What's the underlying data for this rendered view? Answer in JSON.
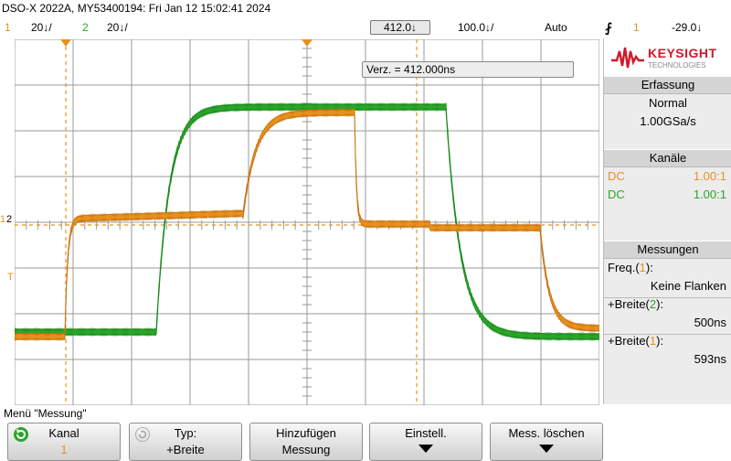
{
  "header": {
    "title": "DSO-X 2022A, MY53400194: Fri Jan 12 15:02:41 2024",
    "ch1_num": "1",
    "ch1_scale": "20↓/",
    "ch2_num": "2",
    "ch2_scale": "20↓/",
    "timebase_delay": "412.0↓",
    "timebase_scale": "100.0↓/",
    "trigger_mode": "Auto",
    "trigger_icon": "rising-edge-icon",
    "trigger_channel": "1",
    "trigger_level": "-29.0↓"
  },
  "screen": {
    "delay_readout": "Verz. = 412.000ns",
    "ch1_marker": "1",
    "ch2_marker": "2",
    "trigger_marker": "T",
    "grid": "on",
    "colors": {
      "ch1": "#e8901c",
      "ch2": "#2aa52a"
    }
  },
  "panel": {
    "brand": "KEYSIGHT",
    "brand_sub": "TECHNOLOGIES",
    "acq_head": "Erfassung",
    "acq_mode": "Normal",
    "acq_rate": "1.00GSa/s",
    "chan_head": "Kanäle",
    "ch1_coupling": "DC",
    "ch1_probe": "1.00:1",
    "ch2_coupling": "DC",
    "ch2_probe": "1.00:1",
    "meas_head": "Messungen",
    "m1_label": "Freq.(",
    "m1_ch": "1",
    "m1_close": "):",
    "m1_value": "Keine Flanken",
    "m2_label": "+Breite(",
    "m2_ch": "2",
    "m2_close": "):",
    "m2_value": "500ns",
    "m3_label": "+Breite(",
    "m3_ch": "1",
    "m3_close": "):",
    "m3_value": "593ns"
  },
  "menu": {
    "title": "Menü \"Messung\"",
    "keys": [
      {
        "label": "Kanal",
        "value": "1"
      },
      {
        "label": "Typ:",
        "value": "+Breite"
      },
      {
        "label": "Hinzufügen",
        "value": "Messung"
      },
      {
        "label": "Einstell.",
        "value": ""
      },
      {
        "label": "Mess. löschen",
        "value": ""
      }
    ]
  }
}
